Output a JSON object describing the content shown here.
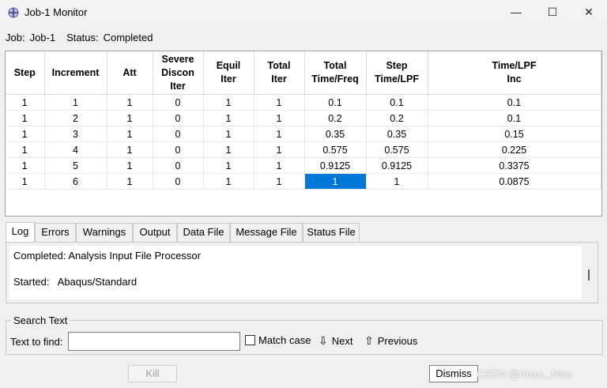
{
  "window": {
    "title": "Job-1 Monitor",
    "min_glyph": "—",
    "max_glyph": "☐",
    "close_glyph": "✕"
  },
  "job": {
    "job_label": "Job:",
    "job_value": "Job-1",
    "status_label": "Status:",
    "status_value": "Completed"
  },
  "table": {
    "headers": [
      [
        "Step"
      ],
      [
        "Increment"
      ],
      [
        "Att"
      ],
      [
        "Severe",
        "Discon",
        "Iter"
      ],
      [
        "Equil",
        "Iter"
      ],
      [
        "Total",
        "Iter"
      ],
      [
        "Total",
        "Time/Freq"
      ],
      [
        "Step",
        "Time/LPF"
      ],
      [
        "Time/LPF",
        "Inc"
      ]
    ],
    "rows": [
      [
        "1",
        "1",
        "1",
        "0",
        "1",
        "1",
        "0.1",
        "0.1",
        "0.1"
      ],
      [
        "1",
        "2",
        "1",
        "0",
        "1",
        "1",
        "0.2",
        "0.2",
        "0.1"
      ],
      [
        "1",
        "3",
        "1",
        "0",
        "1",
        "1",
        "0.35",
        "0.35",
        "0.15"
      ],
      [
        "1",
        "4",
        "1",
        "0",
        "1",
        "1",
        "0.575",
        "0.575",
        "0.225"
      ],
      [
        "1",
        "5",
        "1",
        "0",
        "1",
        "1",
        "0.9125",
        "0.9125",
        "0.3375"
      ],
      [
        "1",
        "6",
        "1",
        "0",
        "1",
        "1",
        "1",
        "1",
        "0.0875"
      ]
    ],
    "selected_cell": {
      "row": 5,
      "col": 6
    }
  },
  "tabs": [
    "Log",
    "Errors",
    "Warnings",
    "Output",
    "Data File",
    "Message File",
    "Status File"
  ],
  "active_tab": "Log",
  "log": {
    "line1": "Completed: Analysis Input File Processor",
    "line2": "Started:   Abaqus/Standard"
  },
  "search": {
    "legend": "Search Text",
    "find_label": "Text to find:",
    "find_value": "",
    "match_case_label": "Match case",
    "match_case_checked": false,
    "next_label": "Next",
    "previous_label": "Previous"
  },
  "buttons": {
    "kill": "Kill",
    "dismiss": "Dismiss"
  },
  "watermark": "CSDN @Amor,,,Niss",
  "colors": {
    "selection": "#0078d7"
  }
}
